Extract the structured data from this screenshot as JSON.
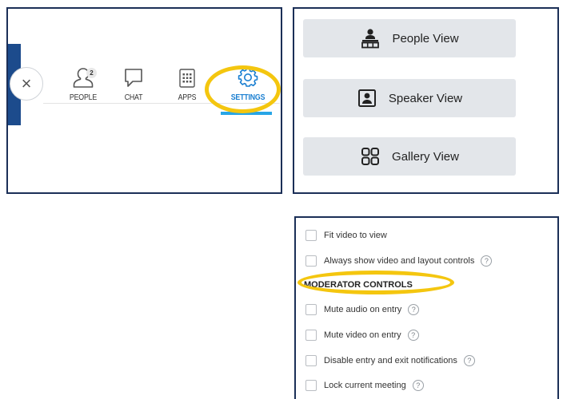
{
  "toolbar": {
    "close_symbol": "×",
    "people": {
      "label": "PEOPLE",
      "badge": "2"
    },
    "chat": {
      "label": "CHAT"
    },
    "apps": {
      "label": "APPS"
    },
    "settings": {
      "label": "SETTINGS"
    },
    "icons": [
      "close-icon",
      "people-icon",
      "chat-icon",
      "apps-icon",
      "gear-icon"
    ],
    "accent_color": "#1a7fd1",
    "highlight_color": "#f4c60f",
    "sidebar_color": "#1c4b8c"
  },
  "views": {
    "buttons": [
      {
        "label": "People View",
        "icon": "people-view-icon"
      },
      {
        "label": "Speaker View",
        "icon": "speaker-view-icon"
      },
      {
        "label": "Gallery View",
        "icon": "gallery-view-icon"
      }
    ]
  },
  "settings": {
    "fit_video": "Fit video to view",
    "always_show": "Always show video and layout controls",
    "section_title": "MODERATOR CONTROLS",
    "mute_audio": "Mute audio on entry",
    "mute_video": "Mute video on entry",
    "disable_notifications": "Disable entry and exit notifications",
    "lock_meeting": "Lock current meeting",
    "help_symbol": "?"
  }
}
